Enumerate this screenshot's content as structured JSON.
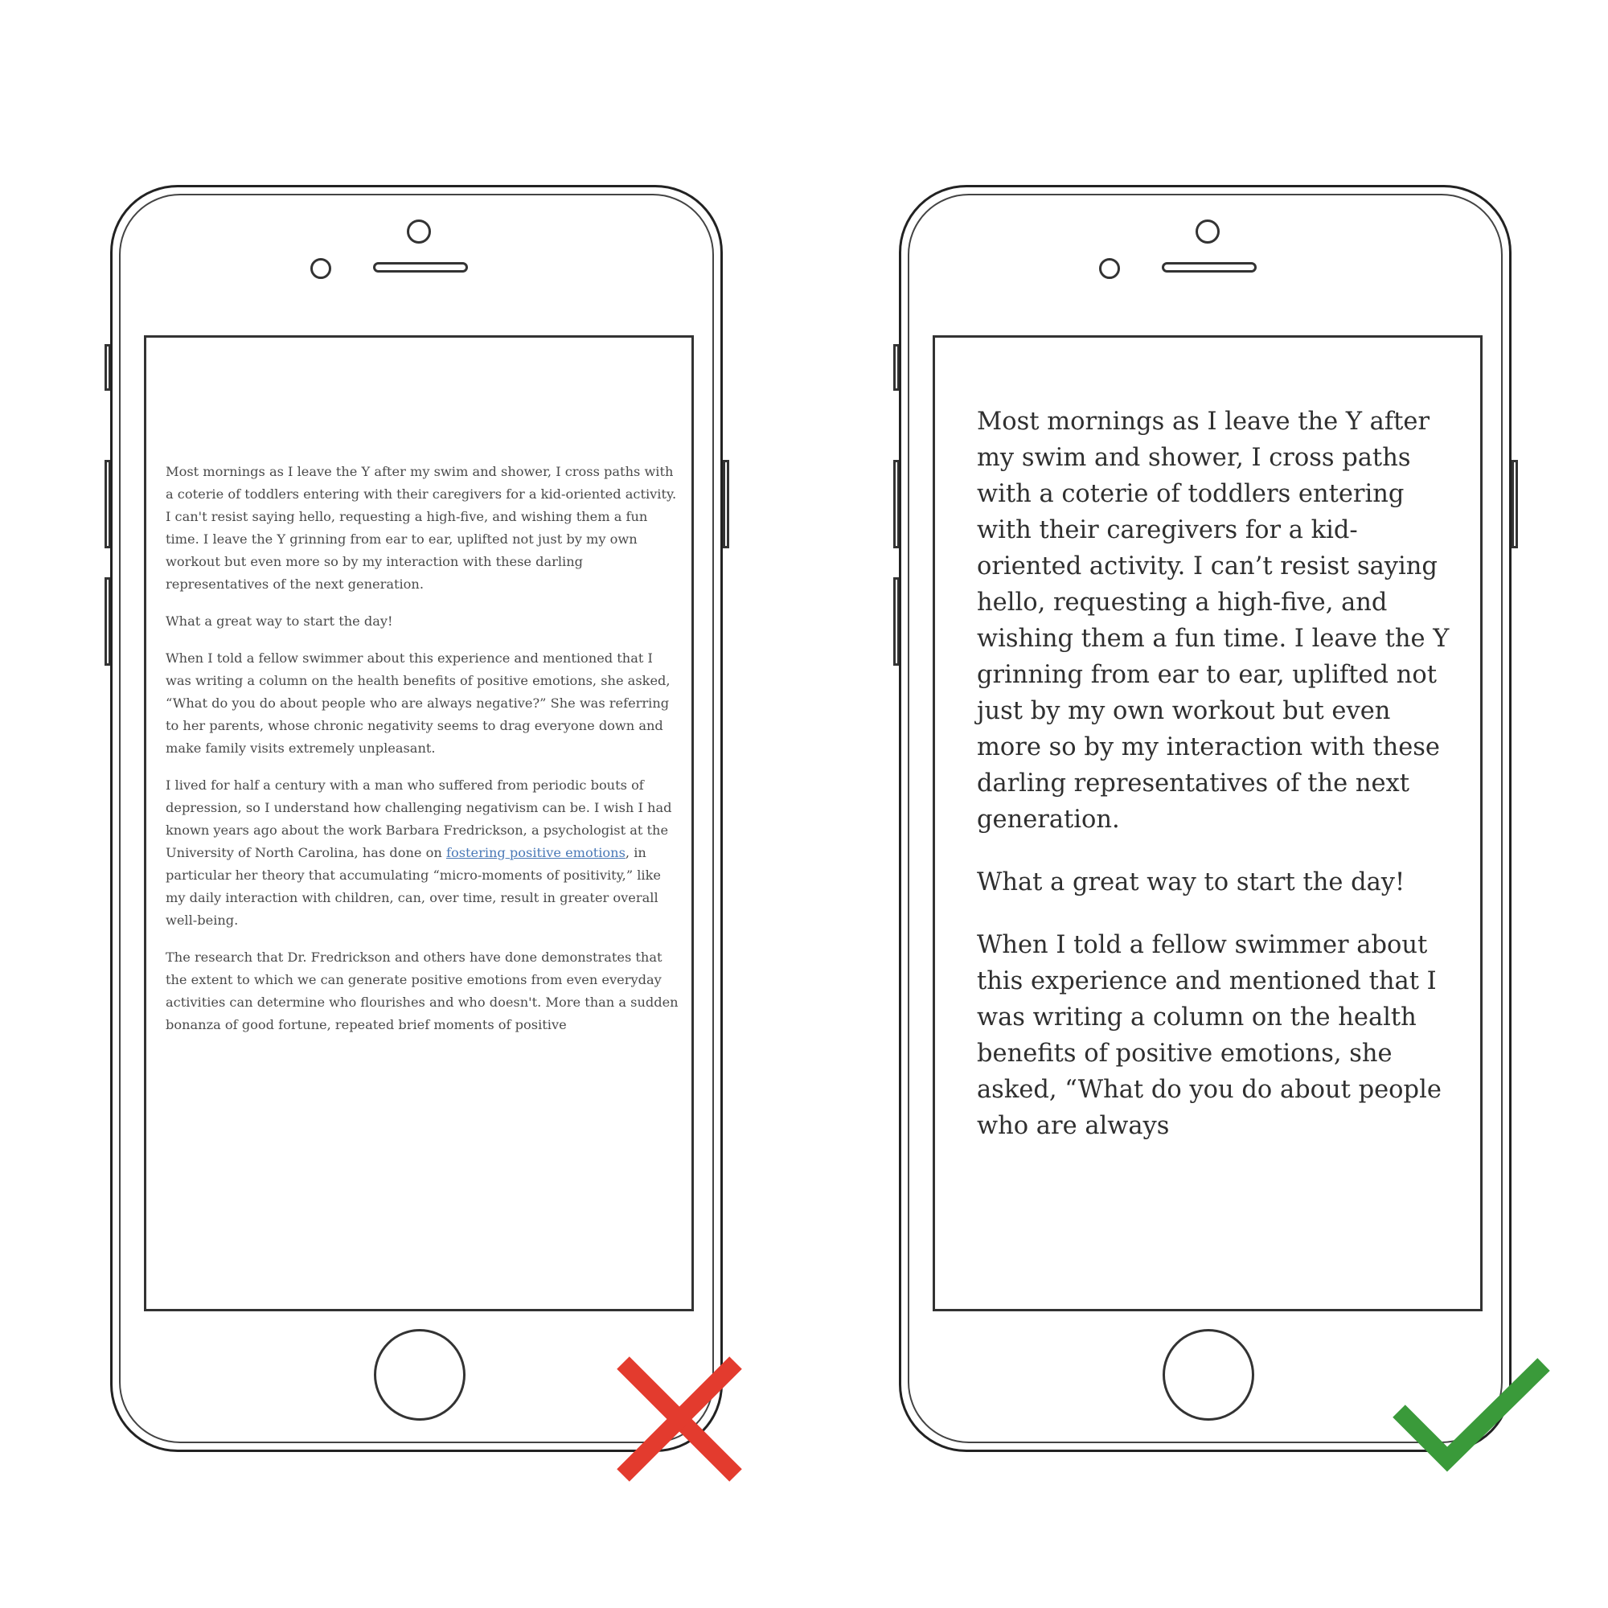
{
  "colors": {
    "outline": "#333333",
    "text": "#2f2f2f",
    "link": "#4a79b7",
    "wrong_mark": "#e33b2e",
    "right_mark": "#3a9a3a"
  },
  "icons": {
    "wrong": "x-icon",
    "right": "checkmark-icon"
  },
  "bad_example": {
    "paragraphs": [
      "Most mornings as I leave the Y after my swim and shower, I cross paths with a coterie of toddlers entering with their caregivers for a kid-oriented activity. I can't resist saying hello, requesting a high-five, and wishing them a fun time. I leave the Y grinning from ear to ear, uplifted not just by my own workout but even more so by my interaction with these darling representatives of the next generation.",
      "What a great way to start the day!",
      "When I told a fellow swimmer about this experience and mentioned that I was writing a column on the health benefits of positive emotions, she asked, “What do you do about people who are always negative?” She was referring to her parents, whose chronic negativity seems to drag everyone down and make family visits extremely unpleasant."
    ],
    "p4_before": "I lived for half a century with a man who suffered from periodic bouts of depression, so I understand how challenging negativism can be. I wish I had known years ago about the work Barbara Fredrickson, a psychologist at the University of North Carolina, has done on ",
    "p4_link": "fostering positive emotions",
    "p4_after": ", in particular her theory that accumulating “micro-moments of positivity,” like my daily interaction with children, can, over time, result in greater overall well-being.",
    "p5": "The research that Dr. Fredrickson and others have done demonstrates that the extent to which we can generate positive emotions from even everyday activities can determine who flourishes and who doesn't. More than a sudden bonanza of good fortune, repeated brief moments of positive"
  },
  "good_example": {
    "paragraphs": [
      "Most mornings as I leave the Y after my swim and shower, I cross paths with a coterie of toddlers entering with their caregivers for a kid-oriented activity. I can’t resist saying hello, requesting a high-five, and wishing them a fun time. I leave the Y grinning from ear to ear, uplifted not just by my own workout but even more so by my interaction with these darling representatives of the next generation.",
      "What a great way to start the day!",
      "When I told a fellow swimmer about this experience and mentioned that I was writing a column on the health benefits of positive emotions, she asked, “What do you do about people who are always"
    ]
  }
}
